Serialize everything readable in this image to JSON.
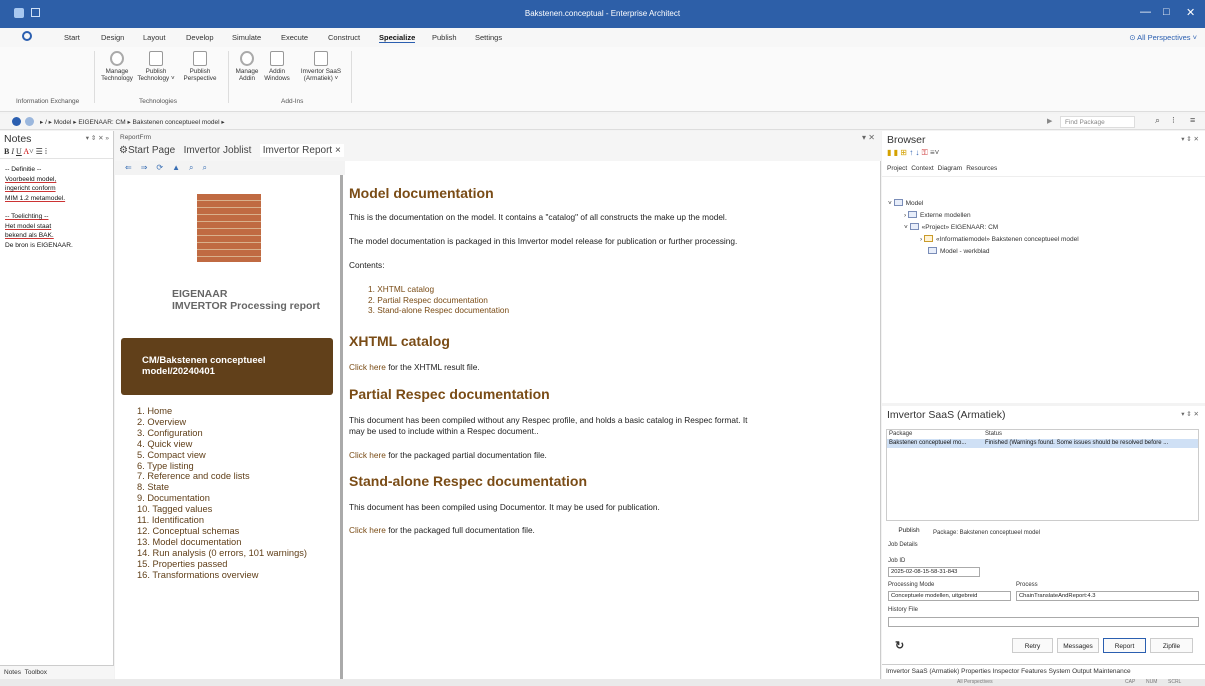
{
  "window": {
    "title": "Bakstenen.conceptual - Enterprise Architect"
  },
  "menu": [
    "Start",
    "Design",
    "Layout",
    "Develop",
    "Simulate",
    "Execute",
    "Construct",
    "Specialize",
    "Publish",
    "Settings"
  ],
  "menu_active": "Specialize",
  "perspectives": "All Perspectives",
  "ribbon": {
    "buttons": [
      {
        "l1": "Manage",
        "l2": "Technology"
      },
      {
        "l1": "Publish",
        "l2": "Technology ˅"
      },
      {
        "l1": "Publish",
        "l2": "Perspective"
      },
      {
        "l1": "Manage",
        "l2": "Addin"
      },
      {
        "l1": "Addin",
        "l2": "Windows"
      },
      {
        "l1": "Imvertor SaaS",
        "l2": "(Armatiek) ˅"
      }
    ],
    "groups": [
      "Information Exchange",
      "Technologies",
      "Add-Ins"
    ]
  },
  "address": {
    "path": "▸ / ▸ Model ▸ EIGENAAR: CM ▸ Bakstenen conceptueel model ▸",
    "find_placeholder": "Find Package"
  },
  "notes": {
    "title": "Notes",
    "body": [
      {
        "t": "-- Definitie --",
        "u": false
      },
      {
        "t": "Voorbeeld model,",
        "u": true
      },
      {
        "t": "ingericht conform",
        "u": true
      },
      {
        "t": "MIM 1.2 metamodel.",
        "u": true
      },
      {
        "t": "",
        "u": false
      },
      {
        "t": "-- Toelichting --",
        "u": true
      },
      {
        "t": "Het model staat",
        "u": true
      },
      {
        "t": "bekend als BAK.",
        "u": true
      },
      {
        "t": "De bron is EIGENAAR.",
        "u": false
      }
    ],
    "tabs": [
      "Notes",
      "Toolbox"
    ]
  },
  "doc_tabs": {
    "report_label": "ReportFrm",
    "items": [
      "Start Page",
      "Imvertor Joblist",
      "Imvertor Report ×"
    ]
  },
  "report": {
    "org": "EIGENAAR",
    "subtitle": "IMVERTOR Processing report",
    "model_box": [
      "CM/Bakstenen conceptueel",
      "model/20240401"
    ],
    "nav": [
      "1. Home",
      "2. Overview",
      "3. Configuration",
      "4. Quick view",
      "5. Compact view",
      "6. Type listing",
      "7. Reference and code lists",
      "8. State",
      "9. Documentation",
      "10. Tagged values",
      "11. Identification",
      "12. Conceptual schemas",
      "13. Model documentation",
      "14. Run analysis (0 errors, 101 warnings)",
      "15. Properties passed",
      "16. Transformations overview"
    ]
  },
  "doc": {
    "h1": "Model documentation",
    "p1": "This is the documentation on the model. It contains a \"catalog\" of all constructs the make up the model.",
    "p2": "The model documentation is packaged in this Imvertor model release for publication or further processing.",
    "contents_label": "Contents:",
    "contents": [
      "1. XHTML catalog",
      "2. Partial Respec documentation",
      "3. Stand-alone Respec documentation"
    ],
    "h2": "XHTML catalog",
    "click_here": "Click here",
    "p3": " for the XHTML result file.",
    "h3": "Partial Respec documentation",
    "p4a": "This document has been compiled without any Respec profile, and holds a basic catalog in Respec format. It",
    "p4b": "may be used to include within a Respec document..",
    "p5": " for the packaged partial documentation file.",
    "h4": "Stand-alone Respec documentation",
    "p6": "This document has been compiled using Documentor. It may be used for publication.",
    "p7": " for the packaged full documentation file."
  },
  "browser": {
    "title": "Browser",
    "tabs": [
      "Project",
      "Context",
      "Diagram",
      "Resources"
    ],
    "tree": [
      "Model",
      "Externe modellen",
      "«Project» EIGENAAR: CM",
      "«Informatiemodel» Bakstenen conceptueel model",
      "Model - werkblad"
    ]
  },
  "saas": {
    "title": "Imvertor SaaS (Armatiek)",
    "col_package": "Package",
    "col_status": "Status",
    "row_package": "Bakstenen conceptueel mo...",
    "row_status": "Finished (Warnings found. Some issues should be resolved before ...",
    "publish": "Publish",
    "package_line": "Package: Bakstenen conceptueel model",
    "job_details": "Job Details",
    "job_id_label": "Job ID",
    "job_id": "2025-02-08-15-58-31-843",
    "mode_label": "Processing Mode",
    "mode": "Conceptuele modellen, uitgebreid",
    "process_label": "Process",
    "process": "ChainTranslateAndReport:4.3",
    "history_label": "History File",
    "buttons": [
      "Retry",
      "Messages",
      "Report",
      "Zipfile"
    ],
    "bottom_tabs": [
      "Imvertor SaaS (Armatiek)",
      "Properties",
      "Inspector",
      "Features",
      "System Output",
      "Maintenance"
    ]
  },
  "status": {
    "perspectives": "All Perspectives",
    "cap": "CAP",
    "num": "NUM",
    "scrl": "SCRL"
  }
}
